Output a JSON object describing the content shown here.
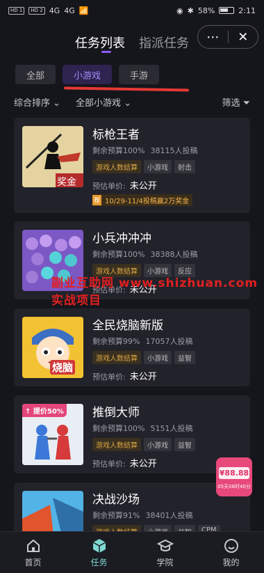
{
  "status_bar": {
    "left_labels": [
      "HD 1",
      "HD 2",
      "4G",
      "4G"
    ],
    "battery": "58%",
    "time": "2:11"
  },
  "header": {
    "tabs": [
      "任务列表",
      "指派任务"
    ],
    "more_icon": "⋯",
    "close_icon": "✕"
  },
  "filters": {
    "chips": [
      "全部",
      "小游戏",
      "手游"
    ],
    "sort": "综合排序",
    "category": "全部小游戏",
    "filter": "筛选"
  },
  "cards": [
    {
      "title": "标枪王者",
      "budget": "剩余预算100%",
      "count": "38115人投稿",
      "tags": [
        "游戏人数结算",
        "小游戏",
        "射击"
      ],
      "price_label": "预估单价:",
      "price": "未公开",
      "promo": "10/29-11/4投稿赢2万奖金",
      "promo_icon": "荐",
      "thumb_text": "奖金"
    },
    {
      "title": "小兵冲冲冲",
      "budget": "剩余预算100%",
      "count": "38388人投稿",
      "tags": [
        "游戏人数结算",
        "小游戏",
        "反应"
      ],
      "price_label": "预估单价:",
      "price": "未公开"
    },
    {
      "title": "全民烧脑新版",
      "budget": "剩余预算99%",
      "count": "17057人投稿",
      "tags": [
        "游戏人数结算",
        "小游戏",
        "益智"
      ],
      "price_label": "预估单价:",
      "price": "未公开",
      "thumb_text": "烧脑"
    },
    {
      "title": "推倒大师",
      "budget": "剩余预算100%",
      "count": "5151人投稿",
      "tags": [
        "游戏人数结算",
        "小游戏",
        "益智"
      ],
      "price_label": "预估单价:",
      "price": "未公开",
      "badge": "提价50%"
    },
    {
      "title": "决战沙场",
      "budget": "剩余预算91%",
      "count": "38401人投稿",
      "tags": [
        "游戏人数结算",
        "小游戏",
        "益智",
        "CPM"
      ]
    }
  ],
  "watermark": "副业互助网 www.shizhuan.com 实战项目",
  "float_badge": {
    "amount": "¥88.88",
    "countdown": "05天08时40分"
  },
  "bottom_nav": [
    "首页",
    "任务",
    "学院",
    "我的"
  ]
}
